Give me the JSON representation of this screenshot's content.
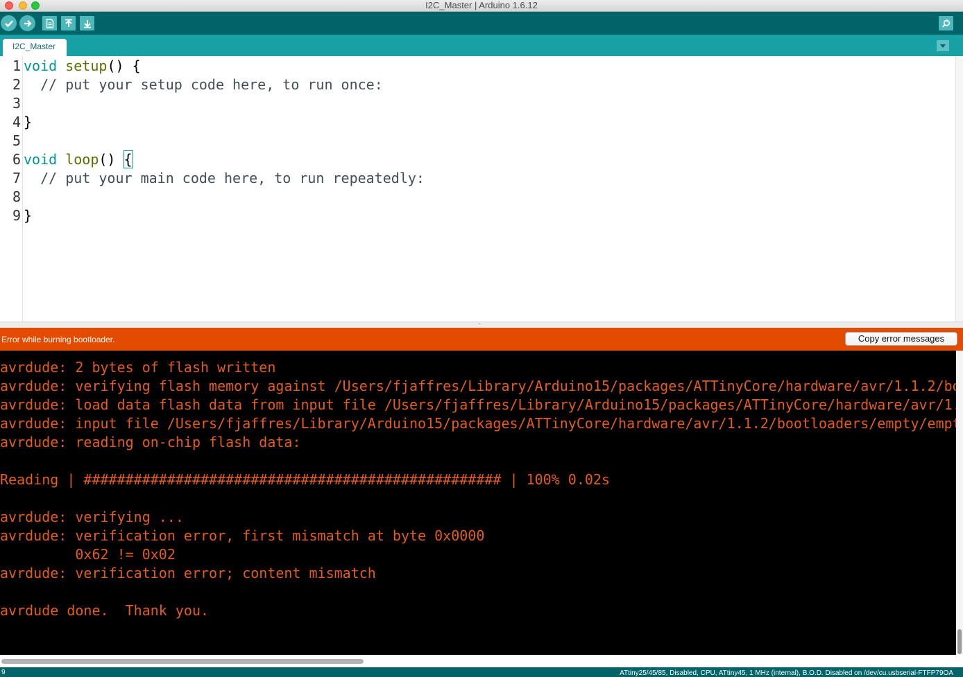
{
  "window": {
    "title": "I2C_Master | Arduino 1.6.12"
  },
  "toolbar": {
    "verify": "check-icon",
    "upload": "arrow-right-icon",
    "new": "new-file-icon",
    "open": "open-arrow-up-icon",
    "save": "save-arrow-down-icon",
    "serial_monitor": "magnifier-icon"
  },
  "tabs": [
    {
      "label": "I2C_Master",
      "active": true
    }
  ],
  "editor": {
    "lines": [
      {
        "num": "1"
      },
      {
        "num": "2"
      },
      {
        "num": "3"
      },
      {
        "num": "4"
      },
      {
        "num": "5"
      },
      {
        "num": "6"
      },
      {
        "num": "7"
      },
      {
        "num": "8"
      },
      {
        "num": "9"
      }
    ],
    "code": {
      "l1_kw": "void",
      "l1_fn": "setup",
      "l1_rest": "() {",
      "l2": "  // put your setup code here, to run once:",
      "l4": "}",
      "l6_kw": "void",
      "l6_fn": "loop",
      "l6_rest": "() ",
      "l6_brace": "{",
      "l7": "  // put your main code here, to run repeatedly:",
      "l9": "}"
    }
  },
  "status": {
    "message": "Error while burning bootloader.",
    "copy_button": "Copy error messages"
  },
  "console": {
    "lines": [
      "avrdude: 2 bytes of flash written",
      "avrdude: verifying flash memory against /Users/fjaffres/Library/Arduino15/packages/ATTinyCore/hardware/avr/1.1.2/bo",
      "avrdude: load data flash data from input file /Users/fjaffres/Library/Arduino15/packages/ATTinyCore/hardware/avr/1.",
      "avrdude: input file /Users/fjaffres/Library/Arduino15/packages/ATTinyCore/hardware/avr/1.1.2/bootloaders/empty/empt",
      "avrdude: reading on-chip flash data:",
      "",
      "Reading | ################################################## | 100% 0.02s",
      "",
      "avrdude: verifying ...",
      "avrdude: verification error, first mismatch at byte 0x0000",
      "         0x62 != 0x02",
      "avrdude: verification error; content mismatch",
      "",
      "avrdude done.  Thank you."
    ]
  },
  "bottom_bar": {
    "line_number": "9",
    "board_info": "ATtiny25/45/85, Disabled, CPU, ATtiny45, 1 MHz (internal), B.O.D. Disabled on /dev/cu.usbserial-FTFP79OA"
  },
  "colors": {
    "toolbar": "#006468",
    "tabstrip": "#17a1a5",
    "error_bar": "#e34c00",
    "console_text": "#e45c1c",
    "keyword": "#00979c",
    "function": "#5e6d03"
  }
}
